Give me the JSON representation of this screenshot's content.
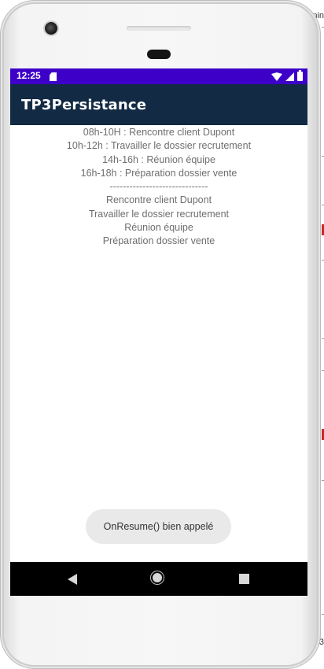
{
  "background_window": {
    "top_text": "nin",
    "bottom_text": "3"
  },
  "status_bar": {
    "time": "12:25",
    "color": "#3c00c8",
    "icons": [
      "sd-card-icon",
      "wifi-icon",
      "signal-icon",
      "battery-icon"
    ]
  },
  "app_bar": {
    "title": "TP3Persistance",
    "color": "#122a44"
  },
  "content": {
    "schedule": [
      "08h-10H : Rencontre client Dupont",
      "10h-12h : Travailler le dossier recrutement",
      "14h-16h : Réunion équipe",
      "16h-18h : Préparation dossier vente"
    ],
    "separator": "------------------------------",
    "tasks": [
      "Rencontre client Dupont",
      "Travailler le dossier recrutement",
      "Réunion équipe",
      "Préparation dossier vente"
    ]
  },
  "toast": {
    "message": "OnResume() bien appelé"
  },
  "nav_bar": {
    "icons": [
      "back-icon",
      "home-icon",
      "recents-icon"
    ]
  }
}
